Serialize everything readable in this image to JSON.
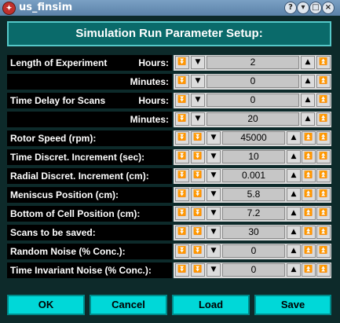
{
  "window": {
    "title": "us_finsim",
    "buttons": [
      "?",
      "▾",
      "□",
      "×"
    ]
  },
  "header": "Simulation Run Parameter Setup:",
  "rows": {
    "exp_hours": {
      "label": "Length of Experiment",
      "sublabel": "Hours:",
      "value": "2"
    },
    "exp_minutes": {
      "sublabel": "Minutes:",
      "value": "0"
    },
    "delay_hours": {
      "label": "Time Delay for Scans",
      "sublabel": "Hours:",
      "value": "0"
    },
    "delay_minutes": {
      "sublabel": "Minutes:",
      "value": "20"
    },
    "rotor": {
      "label": "Rotor Speed (rpm):",
      "value": "45000"
    },
    "time_incr": {
      "label": "Time Discret. Increment (sec):",
      "value": "10"
    },
    "radial_incr": {
      "label": "Radial Discret. Increment (cm):",
      "value": "0.001"
    },
    "meniscus": {
      "label": "Meniscus Position (cm):",
      "value": "5.8"
    },
    "bottom": {
      "label": "Bottom of Cell Position (cm):",
      "value": "7.2"
    },
    "scans": {
      "label": "Scans to be saved:",
      "value": "30"
    },
    "random_noise": {
      "label": "Random Noise (% Conc.):",
      "value": "0"
    },
    "ti_noise": {
      "label": "Time Invariant Noise (% Conc.):",
      "value": "0"
    }
  },
  "icons": {
    "down3": "⇊̲",
    "down2": "⇊",
    "down1": "▼",
    "up1": "▲",
    "up2": "⇈"
  },
  "footer": {
    "ok": "OK",
    "cancel": "Cancel",
    "load": "Load",
    "save": "Save"
  },
  "colors": {
    "header_bg": "#0a6a6a",
    "button_bg": "#00d8d8",
    "field_bg": "#c6c6c6"
  }
}
